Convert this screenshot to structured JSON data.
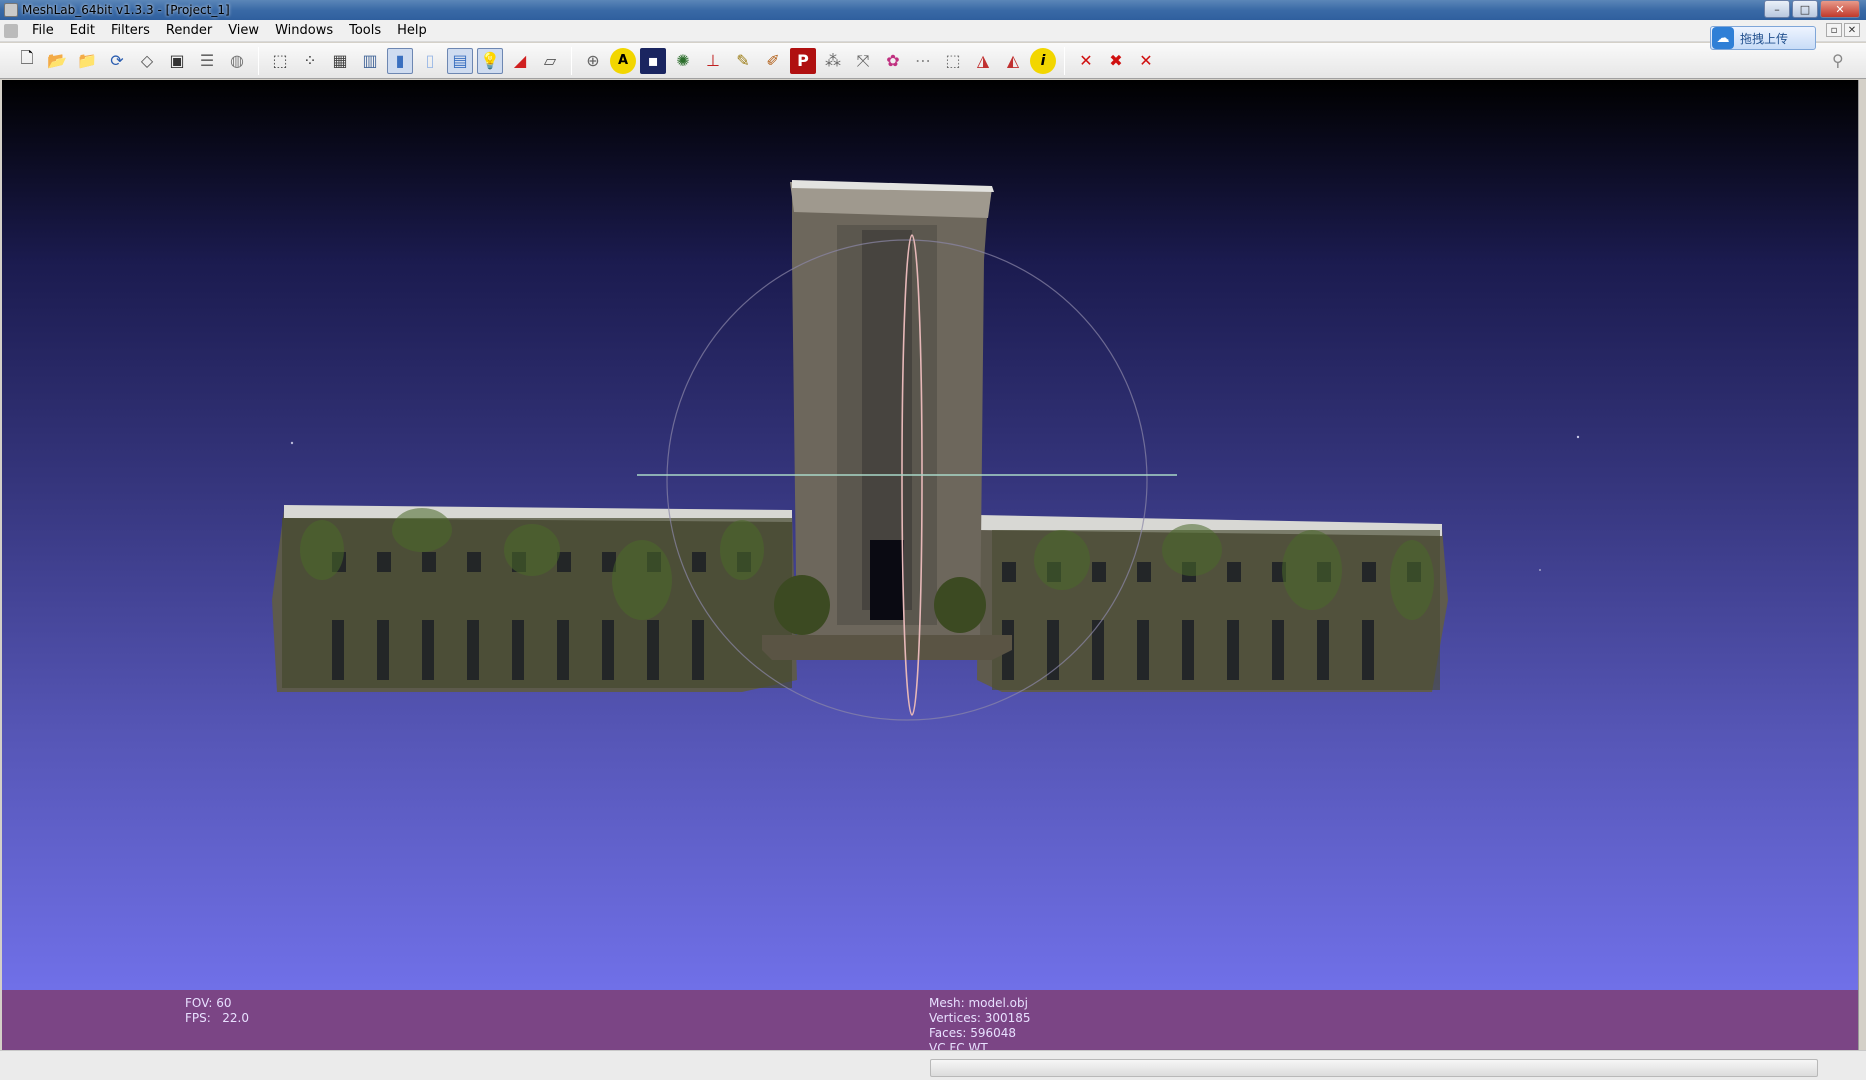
{
  "window": {
    "title": "MeshLab_64bit v1.3.3 - [Project_1]"
  },
  "menu": {
    "items": [
      "File",
      "Edit",
      "Filters",
      "Render",
      "View",
      "Windows",
      "Tools",
      "Help"
    ]
  },
  "upload_button": {
    "label": "拖拽上传"
  },
  "toolbar": {
    "group1": [
      "new-project-icon",
      "open-project-icon",
      "import-mesh-icon",
      "reload-icon",
      "export-mesh-icon",
      "snapshot-icon",
      "layers-icon",
      "mesh-icon"
    ],
    "group2": [
      "bbox-icon",
      "points-icon",
      "wireframe-icon",
      "hidden-lines-icon",
      "flat-shading-icon",
      "smooth-shading-icon",
      "texture-icon",
      "light-icon",
      "fancy-light-icon",
      "backface-icon"
    ],
    "group3": [
      "trackball-icon",
      "annotation-icon",
      "raster-icon",
      "sphere-icon",
      "axis-icon",
      "paint-icon",
      "brush-icon",
      "pick-points-icon",
      "align-icon",
      "measure-icon",
      "color-icon",
      "reference-icon",
      "select-icon",
      "select-faces-icon",
      "select-vertices-icon",
      "info-icon"
    ],
    "group4": [
      "delete-selection-icon",
      "delete-faces-icon",
      "delete-vertices-icon"
    ]
  },
  "info": {
    "fov": "FOV: 60",
    "fps": "FPS:   22.0",
    "mesh": "Mesh: model.obj",
    "vertices": "Vertices: 300185",
    "faces": "Faces: 596048",
    "flags": "VC FC WT"
  }
}
